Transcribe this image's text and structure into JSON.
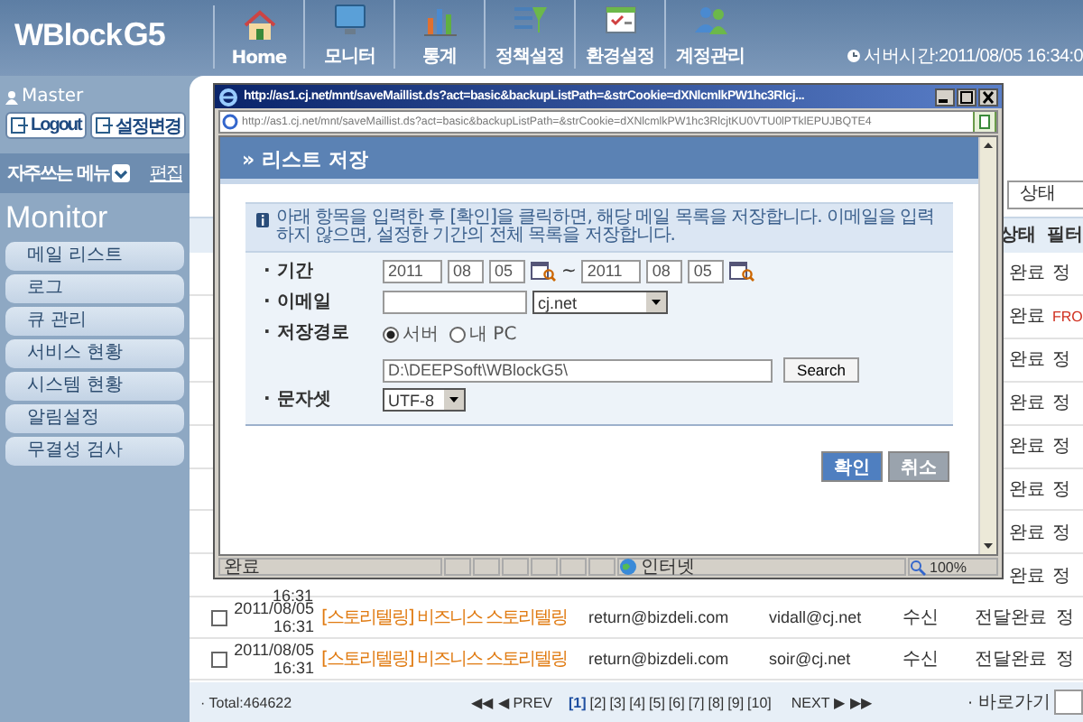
{
  "header": {
    "logo": "WBlock",
    "logo_suffix": "G5",
    "nav": [
      {
        "label": "Home"
      },
      {
        "label": "모니터"
      },
      {
        "label": "통계"
      },
      {
        "label": "정책설정"
      },
      {
        "label": "환경설정"
      },
      {
        "label": "계정관리"
      }
    ],
    "server_time": "서버시간:2011/08/05 16:34:0"
  },
  "sidebar": {
    "user": "Master",
    "buttons": [
      "Logout",
      "설정변경"
    ],
    "favorites": "자주쓰는 메뉴",
    "edit": "편집",
    "section": "Monitor",
    "items": [
      "메일 리스트",
      "로그",
      "큐 관리",
      "서비스 현황",
      "시스템 현황",
      "알림설정",
      "무결성 검사"
    ]
  },
  "list": {
    "filter_label": "상태",
    "columns": [
      "상태",
      "필터"
    ],
    "covered_rows": [
      {
        "status": "완료",
        "filter": "정",
        "alert": false
      },
      {
        "status": "완료",
        "filter": "FRO",
        "alert": true
      },
      {
        "status": "완료",
        "filter": "정",
        "alert": false
      },
      {
        "status": "완료",
        "filter": "정",
        "alert": false
      },
      {
        "status": "완료",
        "filter": "정",
        "alert": false
      },
      {
        "status": "완료",
        "filter": "정",
        "alert": false
      },
      {
        "status": "완료",
        "filter": "정",
        "alert": false
      },
      {
        "status": "완료",
        "filter": "정",
        "alert": false,
        "time": "16:31"
      }
    ],
    "rows": [
      {
        "checked": false,
        "date": "2011/08/05",
        "time": "16:31",
        "subject": "[스토리텔링] 비즈니스 스토리텔링",
        "sender": "return@bizdeli.com",
        "receiver": "vidall@cj.net",
        "direction": "수신",
        "status": "전달완료",
        "filter": "정"
      },
      {
        "checked": false,
        "date": "2011/08/05",
        "time": "16:31",
        "subject": "[스토리텔링] 비즈니스 스토리텔링",
        "sender": "return@bizdeli.com",
        "receiver": "soir@cj.net",
        "direction": "수신",
        "status": "전달완료",
        "filter": "정"
      }
    ],
    "total": "· Total:464622",
    "first": "◀◀",
    "prev": "◀ PREV",
    "pages": [
      {
        "label": "[1]",
        "selected": true
      },
      {
        "label": "[2]",
        "selected": false
      },
      {
        "label": "[3]",
        "selected": false
      },
      {
        "label": "[4]",
        "selected": false
      },
      {
        "label": "[5]",
        "selected": false
      },
      {
        "label": "[6]",
        "selected": false
      },
      {
        "label": "[7]",
        "selected": false
      },
      {
        "label": "[8]",
        "selected": false
      },
      {
        "label": "[9]",
        "selected": false
      },
      {
        "label": "[10]",
        "selected": false
      }
    ],
    "next": "NEXT ▶",
    "last": "▶▶",
    "goto": "· 바로가기"
  },
  "popup": {
    "title": "http://as1.cj.net/mnt/saveMaillist.ds?act=basic&backupListPath=&strCookie=dXNlcmlkPW1hc3Rlcj...",
    "url": "http://as1.cj.net/mnt/saveMaillist.ds?act=basic&backupListPath=&strCookie=dXNlcmlkPW1hc3RlcjtKU0VTU0lPTklEPUJBQTE4",
    "heading": "» 리스트 저장",
    "info": "아래 항목을 입력한 후 [확인]을 클릭하면, 해당 메일 목록을 저장합니다. 이메일을 입력하지 않으면, 설정한 기간의 전체 목록을 저장합니다.",
    "fields": [
      {
        "kind": "date_range",
        "label": "· 기간",
        "from": [
          "2011",
          "08",
          "05"
        ],
        "separator": "~",
        "to": [
          "2011",
          "08",
          "05"
        ]
      },
      {
        "kind": "email",
        "label": "· 이메일",
        "domain": "cj.net"
      },
      {
        "kind": "path",
        "label": "· 저장경로",
        "options": [
          {
            "label": "서버",
            "selected": true
          },
          {
            "label": "내 PC",
            "selected": false
          }
        ],
        "value": "D:\\DEEPSoft\\WBlockG5\\",
        "button": "Search"
      },
      {
        "kind": "select",
        "label": "· 문자셋",
        "value": "UTF-8"
      }
    ],
    "buttons": [
      "확인",
      "취소"
    ],
    "status": "완료",
    "zone": "인터넷",
    "zoom": "100%"
  }
}
